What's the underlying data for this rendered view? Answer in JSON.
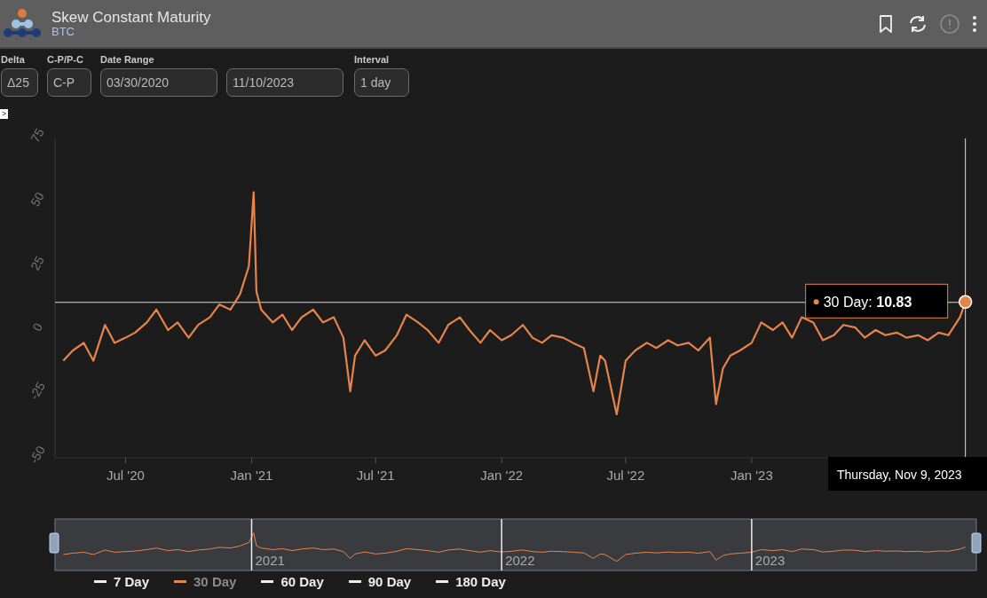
{
  "header": {
    "title": "Skew Constant Maturity",
    "subtitle": "BTC",
    "info_disabled": true
  },
  "controls": [
    {
      "label": "Delta",
      "value": "Δ25"
    },
    {
      "label": "C-P/P-C",
      "value": "C-P"
    },
    {
      "label": "Date Range",
      "value": "03/30/2020"
    },
    {
      "value": "11/10/2023"
    },
    {
      "label": "Interval",
      "value": "1 day"
    }
  ],
  "panel_toggle": ">",
  "chart": {
    "chart_data": {
      "type": "line",
      "xlim": [
        "2020-03-20",
        "2023-11-25"
      ],
      "ylim": [
        -50,
        75
      ],
      "ref_lines": [
        {
          "axis": "y",
          "value": 10.83
        },
        {
          "axis": "x",
          "value": "2023-11-09"
        }
      ],
      "yticks": [
        -50,
        -25,
        0,
        25,
        50,
        75
      ],
      "xticks": [
        {
          "value": "2020-07-01",
          "label": "Jul '20"
        },
        {
          "value": "2021-01-01",
          "label": "Jan '21"
        },
        {
          "value": "2021-07-01",
          "label": "Jul '21"
        },
        {
          "value": "2022-01-01",
          "label": "Jan '22"
        },
        {
          "value": "2022-07-01",
          "label": "Jul '22"
        },
        {
          "value": "2023-01-01",
          "label": "Jan '23"
        }
      ],
      "x": [
        "2020-04-01",
        "2020-04-15",
        "2020-05-01",
        "2020-05-15",
        "2020-06-01",
        "2020-06-15",
        "2020-07-01",
        "2020-07-15",
        "2020-08-01",
        "2020-08-15",
        "2020-09-01",
        "2020-09-15",
        "2020-10-01",
        "2020-10-15",
        "2020-11-01",
        "2020-11-15",
        "2020-12-01",
        "2020-12-15",
        "2020-12-28",
        "2021-01-04",
        "2021-01-08",
        "2021-01-15",
        "2021-02-01",
        "2021-02-15",
        "2021-03-01",
        "2021-03-15",
        "2021-04-01",
        "2021-04-15",
        "2021-05-01",
        "2021-05-15",
        "2021-05-25",
        "2021-06-01",
        "2021-06-15",
        "2021-07-01",
        "2021-07-15",
        "2021-08-01",
        "2021-08-15",
        "2021-09-01",
        "2021-09-15",
        "2021-10-01",
        "2021-10-15",
        "2021-11-01",
        "2021-11-15",
        "2021-12-01",
        "2021-12-15",
        "2022-01-01",
        "2022-01-15",
        "2022-02-01",
        "2022-02-15",
        "2022-03-01",
        "2022-03-15",
        "2022-04-01",
        "2022-04-15",
        "2022-05-01",
        "2022-05-15",
        "2022-05-25",
        "2022-06-01",
        "2022-06-18",
        "2022-07-01",
        "2022-07-15",
        "2022-08-01",
        "2022-08-15",
        "2022-09-01",
        "2022-09-15",
        "2022-10-01",
        "2022-10-15",
        "2022-11-01",
        "2022-11-10",
        "2022-11-20",
        "2022-12-01",
        "2022-12-15",
        "2023-01-01",
        "2023-01-15",
        "2023-02-01",
        "2023-02-15",
        "2023-03-01",
        "2023-03-15",
        "2023-04-01",
        "2023-04-15",
        "2023-05-01",
        "2023-05-15",
        "2023-06-01",
        "2023-06-15",
        "2023-07-01",
        "2023-07-15",
        "2023-08-01",
        "2023-08-15",
        "2023-09-01",
        "2023-09-15",
        "2023-10-01",
        "2023-10-15",
        "2023-11-01",
        "2023-11-09"
      ],
      "series": [
        {
          "name": "30 Day",
          "color": "#e8834a",
          "values": [
            -12,
            -8,
            -5,
            -12,
            2,
            -5,
            -3,
            -1,
            3,
            8,
            0,
            3,
            -3,
            2,
            5,
            10,
            8,
            14,
            25,
            54,
            15,
            8,
            3,
            6,
            0,
            5,
            8,
            3,
            5,
            -3,
            -24,
            -10,
            -4,
            -10,
            -8,
            -2,
            6,
            3,
            0,
            -5,
            2,
            5,
            0,
            -5,
            0,
            -4,
            -2,
            2,
            -3,
            -5,
            -2,
            -3,
            -5,
            -7,
            -24,
            -10,
            -12,
            -33,
            -12,
            -8,
            -5,
            -7,
            -4,
            -6,
            -5,
            -8,
            -3,
            -29,
            -15,
            -10,
            -8,
            -5,
            3,
            0,
            3,
            -3,
            5,
            3,
            -4,
            -2,
            2,
            1,
            -3,
            0,
            -2,
            -1,
            -3,
            -2,
            -4,
            -1,
            -2,
            5,
            11
          ]
        }
      ]
    },
    "hover": {
      "label": "30 Day: **10.83**",
      "date": "Thursday, Nov 9, 2023"
    },
    "range_slider": {
      "years": [
        "2021",
        "2022",
        "2023"
      ]
    }
  },
  "legend": [
    {
      "label": "7 Day",
      "selected": false
    },
    {
      "kind": "series",
      "selected": true
    },
    {
      "label": "60 Day",
      "selected": false
    },
    {
      "label": "90 Day",
      "selected": false
    },
    {
      "label": "180 Day",
      "selected": false
    }
  ]
}
